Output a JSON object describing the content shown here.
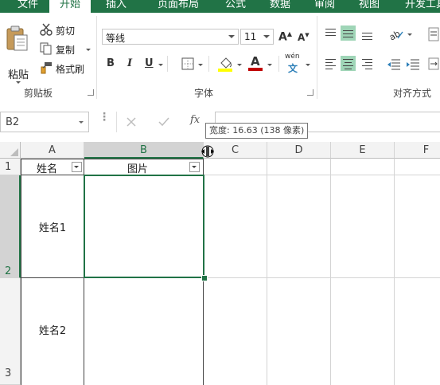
{
  "tabs": [
    {
      "label": "文件",
      "active": false
    },
    {
      "label": "开始",
      "active": true
    },
    {
      "label": "插入",
      "active": false
    },
    {
      "label": "页面布局",
      "active": false
    },
    {
      "label": "公式",
      "active": false
    },
    {
      "label": "数据",
      "active": false
    },
    {
      "label": "审阅",
      "active": false
    },
    {
      "label": "视图",
      "active": false
    },
    {
      "label": "开发工具",
      "active": false
    }
  ],
  "clipboard": {
    "paste_label": "粘贴",
    "cut_label": "剪切",
    "copy_label": "复制",
    "format_painter_label": "格式刷",
    "group_label": "剪贴板"
  },
  "font": {
    "name": "等线",
    "size": "11",
    "bold": "B",
    "italic": "I",
    "underline": "U",
    "grow": "A",
    "shrink": "A",
    "phonetic": "wén",
    "group_label": "字体",
    "fill_color": "#ffff00",
    "font_color": "#c00000"
  },
  "alignment": {
    "group_label": "对齐方式"
  },
  "formula_bar": {
    "name_box": "B2",
    "fx_label": "fx",
    "tooltip": "宽度: 16.63 (138 像素)"
  },
  "sheet": {
    "columns": [
      "A",
      "B",
      "C",
      "D",
      "E",
      "F"
    ],
    "rows": [
      "1",
      "2",
      "3"
    ],
    "header_a": "姓名",
    "header_b": "图片",
    "a2": "姓名1",
    "a3": "姓名2"
  },
  "colors": {
    "accent": "#217346",
    "selected_align": "#9fd5b7"
  }
}
